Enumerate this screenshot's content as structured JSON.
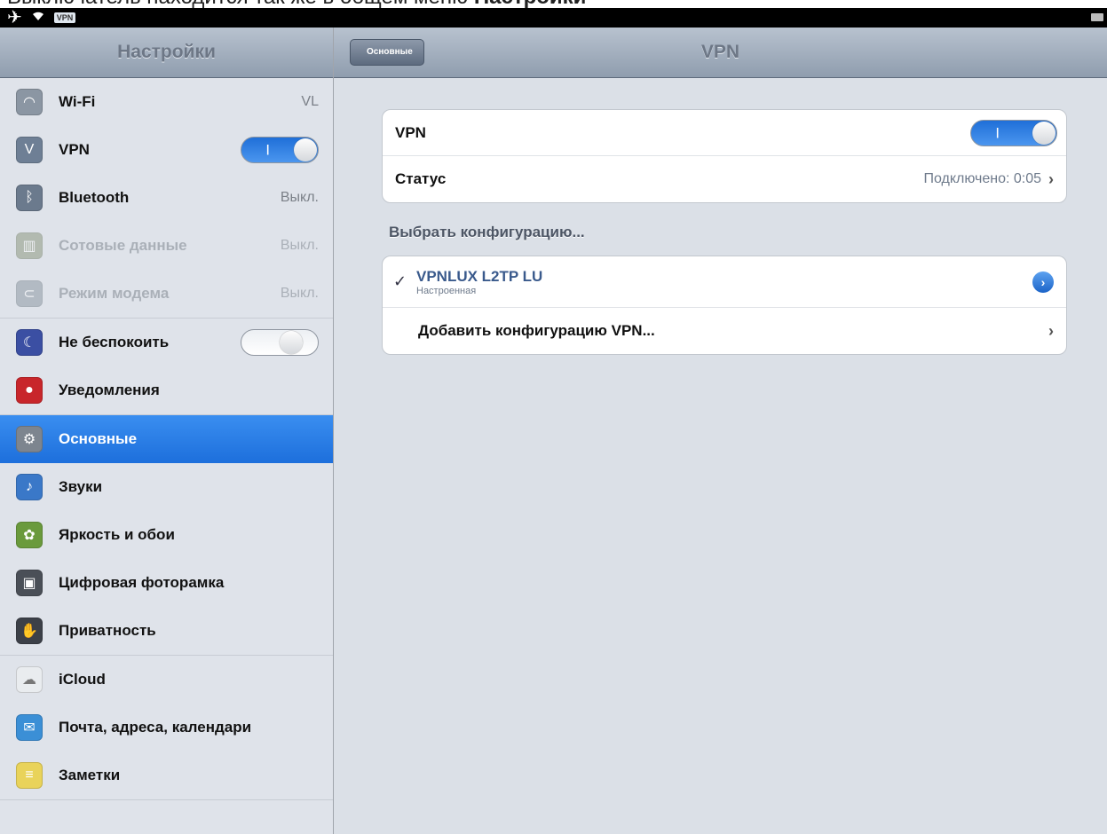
{
  "caption": {
    "text": "Выключатель находится так же в общем меню ",
    "bold": "Настройки"
  },
  "statusbar": {
    "vpn_badge": "VPN",
    "icons": [
      "airplane-icon",
      "wifi-icon",
      "battery-icon"
    ]
  },
  "sidebar": {
    "title": "Настройки",
    "groups": [
      [
        {
          "label": "Wi-Fi",
          "value": "VL",
          "icon": "wifi-settings-icon",
          "color": "#8b96a3"
        },
        {
          "label": "VPN",
          "switch": "on",
          "icon": "vpn-icon",
          "color": "#6e7f95"
        },
        {
          "label": "Bluetooth",
          "value": "Выкл.",
          "icon": "bluetooth-icon",
          "color": "#6b7a8d"
        },
        {
          "label": "Сотовые данные",
          "value": "Выкл.",
          "icon": "cellular-icon",
          "color": "#7d8a6b",
          "disabled": true
        },
        {
          "label": "Режим модема",
          "value": "Выкл.",
          "icon": "hotspot-icon",
          "color": "#7c8a94",
          "disabled": true
        }
      ],
      [
        {
          "label": "Не беспокоить",
          "switch": "off",
          "icon": "moon-icon",
          "color": "#3b4fa3"
        },
        {
          "label": "Уведомления",
          "icon": "notifications-icon",
          "color": "#c8262b"
        }
      ],
      [
        {
          "label": "Основные",
          "icon": "gear-icon",
          "color": "#7d858f",
          "selected": true
        },
        {
          "label": "Звуки",
          "icon": "speaker-icon",
          "color": "#3a78c8"
        },
        {
          "label": "Яркость и обои",
          "icon": "wallpaper-icon",
          "color": "#6a9a3c"
        },
        {
          "label": "Цифровая фоторамка",
          "icon": "photo-frame-icon",
          "color": "#4a4f57"
        },
        {
          "label": "Приватность",
          "icon": "hand-icon",
          "color": "#3c4048"
        }
      ],
      [
        {
          "label": "iCloud",
          "icon": "cloud-icon",
          "color": "#e9ecef"
        },
        {
          "label": "Почта, адреса, календари",
          "icon": "mail-icon",
          "color": "#3b8fd6"
        },
        {
          "label": "Заметки",
          "icon": "notes-icon",
          "color": "#e9d35a"
        }
      ]
    ]
  },
  "detail": {
    "back_label": "Основные",
    "title": "VPN",
    "vpn_row": {
      "label": "VPN",
      "switch": "on"
    },
    "status_row": {
      "label": "Статус",
      "value": "Подключено: 0:05"
    },
    "section_header": "Выбрать конфигурацию...",
    "config": {
      "name": "VPNLUX L2TP LU",
      "sub": "Настроенная"
    },
    "add_config": "Добавить конфигурацию VPN..."
  },
  "colors": {
    "accent": "#1d6fdc",
    "switch_on": "#2f80e4",
    "nav": "#a3aebd"
  }
}
